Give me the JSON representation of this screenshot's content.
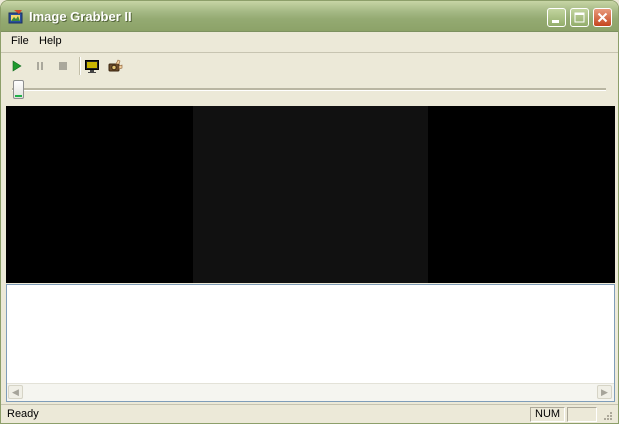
{
  "window": {
    "title": "Image Grabber II",
    "accent_color": "#94aa72",
    "close_color": "#c5461f"
  },
  "menu": {
    "items": [
      {
        "label": "File"
      },
      {
        "label": "Help"
      }
    ]
  },
  "toolbar": {
    "buttons": [
      {
        "icon": "play-icon",
        "enabled": true
      },
      {
        "icon": "pause-icon",
        "enabled": false
      },
      {
        "icon": "stop-icon",
        "enabled": false
      },
      {
        "icon": "monitor-icon",
        "enabled": true
      },
      {
        "icon": "camera-hand-icon",
        "enabled": true
      }
    ]
  },
  "slider": {
    "position_fraction": 0
  },
  "status": {
    "text": "Ready",
    "num_indicator": "NUM"
  }
}
